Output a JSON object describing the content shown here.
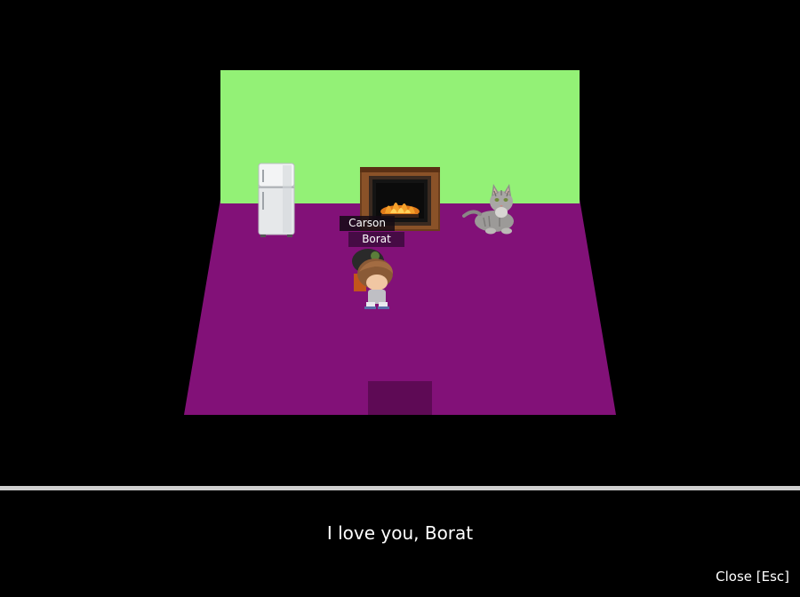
{
  "scene": {
    "colors": {
      "background": "#000000",
      "wall": "#93f176",
      "floor": "#821178",
      "doorway": "#5e0a55",
      "divider": "#cfcfcf"
    },
    "objects": {
      "fridge_icon": "fridge-icon",
      "fireplace_icon": "fireplace-icon",
      "cat_icon": "cat-icon"
    }
  },
  "players": {
    "other_name": "Carson",
    "self_name": "Borat"
  },
  "dialogue": {
    "text": "I love you, Borat",
    "close_label": "Close [Esc]"
  }
}
